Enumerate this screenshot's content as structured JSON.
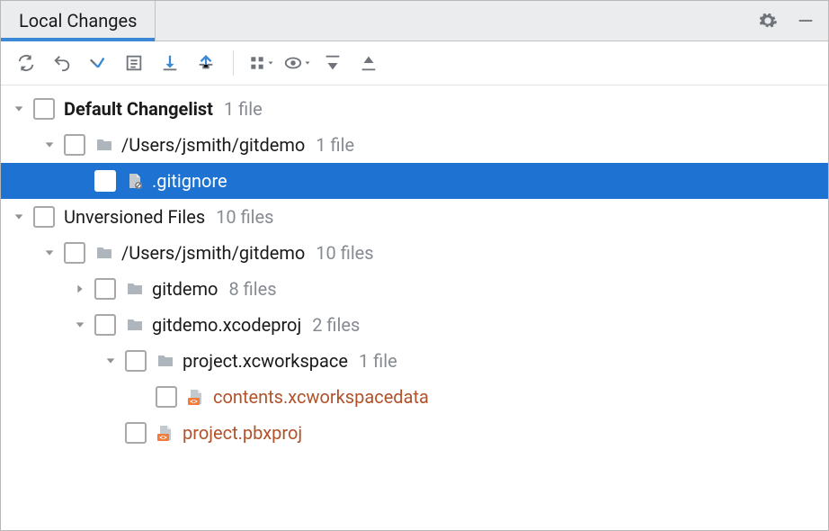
{
  "tab": {
    "title": "Local Changes"
  },
  "toolbar_icons": [
    "refresh",
    "rollback",
    "commit-changes",
    "changelist",
    "shelve",
    "unshelve",
    "group-by",
    "preview",
    "expand-all",
    "collapse-all"
  ],
  "header_icons": [
    "gear",
    "minimize"
  ],
  "tree": [
    {
      "id": "default-changelist",
      "indent": 0,
      "twisty": "down",
      "check": true,
      "icon": null,
      "label": "Default Changelist",
      "bold": true,
      "style": "",
      "count": "1 file",
      "selected": false
    },
    {
      "id": "dc-folder",
      "indent": 1,
      "twisty": "down",
      "check": true,
      "icon": "folder",
      "label": "/Users/jsmith/gitdemo",
      "bold": false,
      "style": "",
      "count": "1 file",
      "selected": false
    },
    {
      "id": "gitignore",
      "indent": 2,
      "twisty": "none",
      "check": true,
      "icon": "file-ignored",
      "label": ".gitignore",
      "bold": false,
      "style": "",
      "count": "",
      "selected": true
    },
    {
      "id": "unversioned",
      "indent": 0,
      "twisty": "down",
      "check": true,
      "icon": null,
      "label": "Unversioned Files",
      "bold": false,
      "style": "",
      "count": "10 files",
      "selected": false
    },
    {
      "id": "uv-folder",
      "indent": 1,
      "twisty": "down",
      "check": true,
      "icon": "folder",
      "label": "/Users/jsmith/gitdemo",
      "bold": false,
      "style": "",
      "count": "10 files",
      "selected": false
    },
    {
      "id": "gitdemo-folder",
      "indent": 2,
      "twisty": "right",
      "check": true,
      "icon": "folder",
      "label": "gitdemo",
      "bold": false,
      "style": "",
      "count": "8 files",
      "selected": false
    },
    {
      "id": "xcodeproj",
      "indent": 2,
      "twisty": "down",
      "check": true,
      "icon": "folder",
      "label": "gitdemo.xcodeproj",
      "bold": false,
      "style": "",
      "count": "2 files",
      "selected": false
    },
    {
      "id": "workspace",
      "indent": 3,
      "twisty": "down",
      "check": true,
      "icon": "folder",
      "label": "project.xcworkspace",
      "bold": false,
      "style": "",
      "count": "1 file",
      "selected": false
    },
    {
      "id": "contentsxcw",
      "indent": 4,
      "twisty": "none",
      "check": true,
      "icon": "file-xml",
      "label": "contents.xcworkspacedata",
      "bold": false,
      "style": "unver",
      "count": "",
      "selected": false
    },
    {
      "id": "pbxproj",
      "indent": 3,
      "twisty": "none",
      "check": true,
      "icon": "file-xml",
      "label": "project.pbxproj",
      "bold": false,
      "style": "unver",
      "count": "",
      "selected": false
    }
  ]
}
